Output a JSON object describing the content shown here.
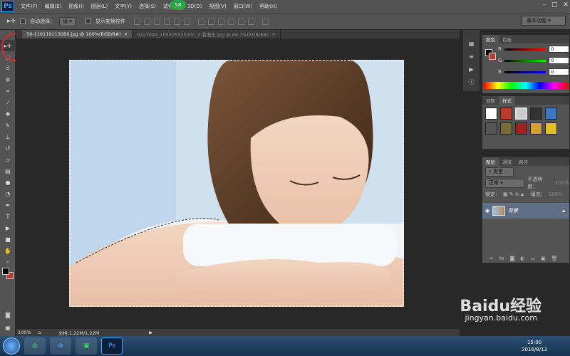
{
  "menubar": {
    "logo": "Ps",
    "items": [
      "文件(F)",
      "编辑(E)",
      "图像(I)",
      "图层(L)",
      "文字(Y)",
      "选择(S)",
      "滤镜(T)",
      "3D(D)",
      "视图(V)",
      "窗口(W)",
      "帮助(H)"
    ],
    "notification_count": "58"
  },
  "options_bar": {
    "auto_select_label": "自动选择：",
    "auto_select_value": "组",
    "show_transform_label": "显示变换控件",
    "workspace": "基本功能"
  },
  "tabs": [
    {
      "label": "56-1101191130B0.jpg @ 100%(RGB/8#)"
    },
    {
      "label": "9227049_155825525000_2.看图王.jpg @ 66.7%(RGB/8#)"
    }
  ],
  "status": {
    "zoom": "100%",
    "doc": "文档:1.22M/1.22M"
  },
  "color_panel": {
    "tabs": [
      "颜色",
      "色板"
    ],
    "r_label": "R",
    "g_label": "G",
    "b_label": "B",
    "r": "0",
    "g": "0",
    "b": "0"
  },
  "adjust_panel": {
    "tabs": [
      "调整",
      "样式"
    ]
  },
  "layers_panel": {
    "tabs": [
      "图层",
      "通道",
      "路径"
    ],
    "filter_label": "类型",
    "blend_mode": "正常",
    "opacity_label": "不透明度：",
    "opacity": "100%",
    "lock_label": "锁定：",
    "fill_label": "填充：",
    "fill": "100%",
    "layer_name": "背景"
  },
  "taskbar": {
    "time": "15:00",
    "date": "2016/8/13"
  },
  "watermark": {
    "brand": "Baidu经验",
    "url": "jingyan.baidu.com"
  }
}
